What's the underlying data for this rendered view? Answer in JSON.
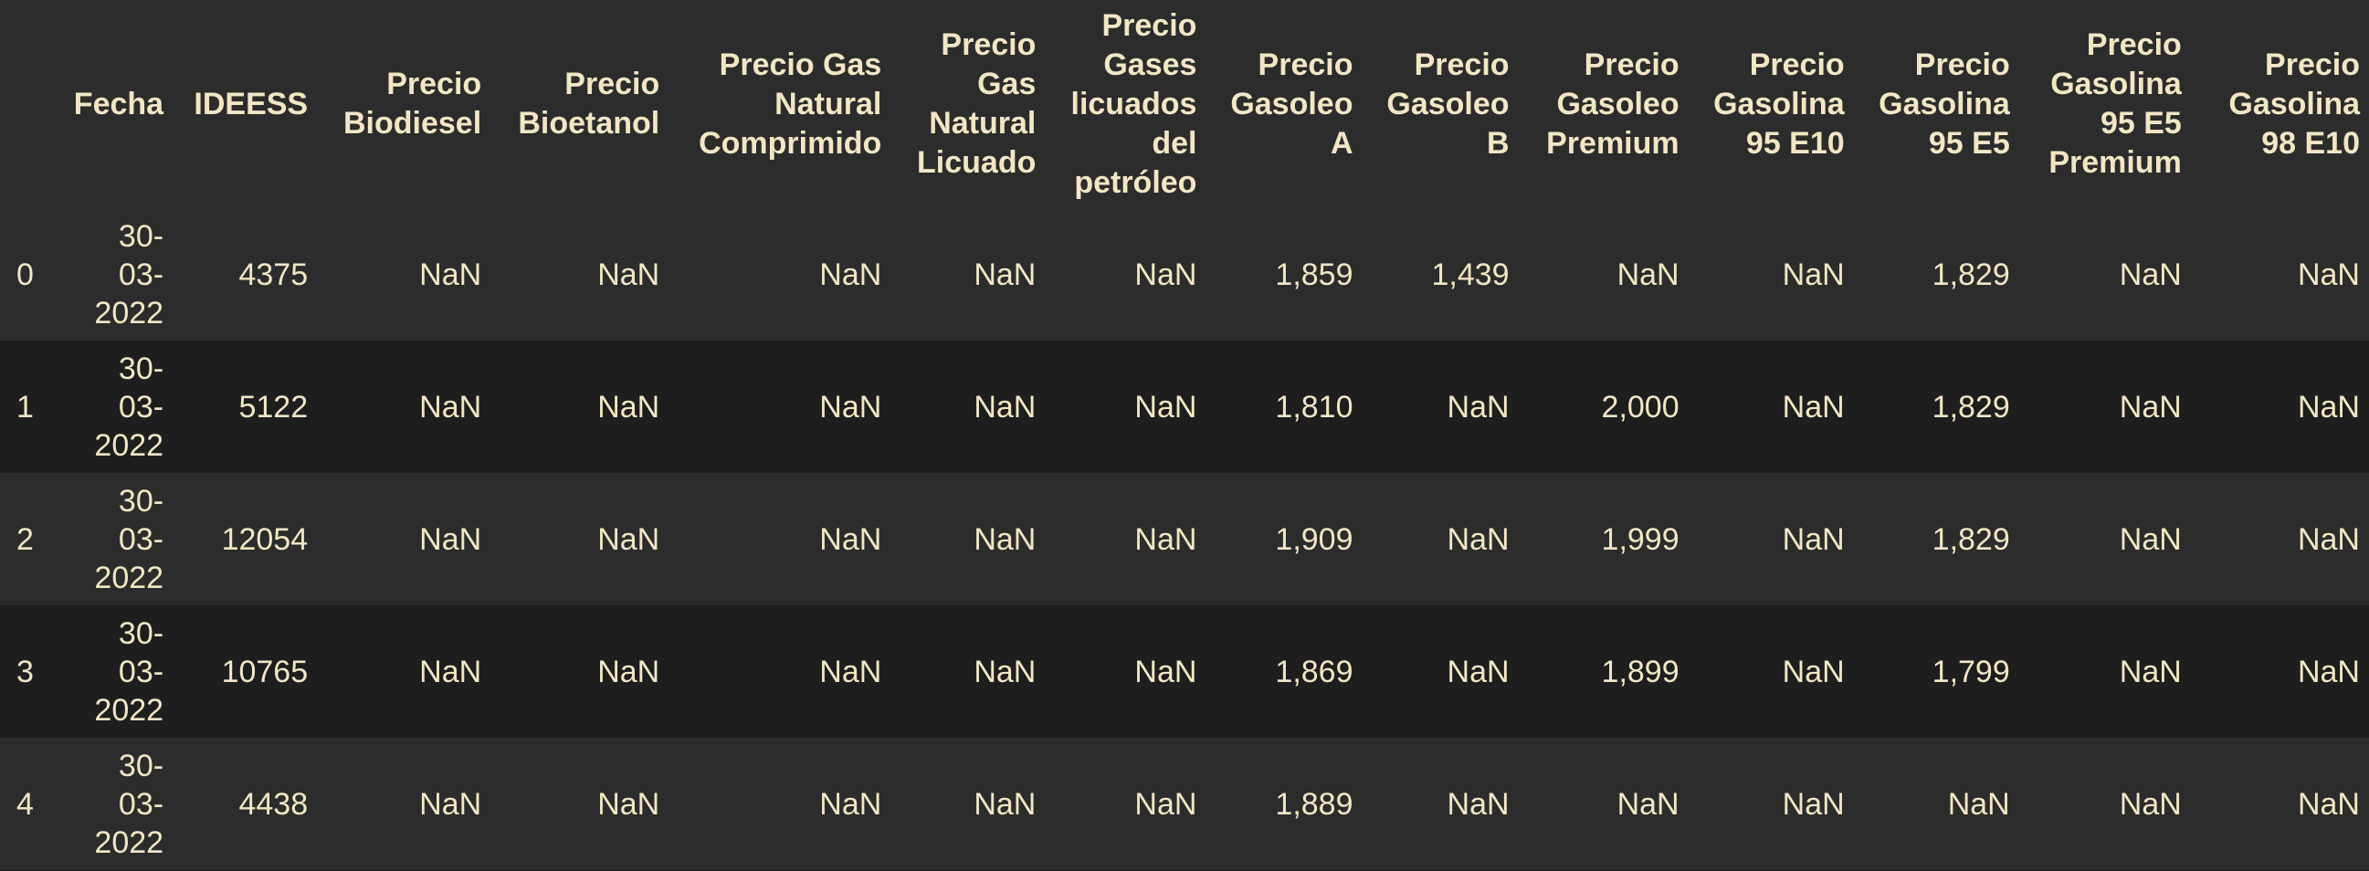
{
  "table": {
    "columns": [
      "",
      "Fecha",
      "IDEESS",
      "Precio Biodiesel",
      "Precio Bioetanol",
      "Precio Gas Natural Comprimido",
      "Precio Gas Natural Licuado",
      "Precio Gases licuados del petróleo",
      "Precio Gasoleo A",
      "Precio Gasoleo B",
      "Precio Gasoleo Premium",
      "Precio Gasolina 95 E10",
      "Precio Gasolina 95 E5",
      "Precio Gasolina 95 E5 Premium",
      "Precio Gasolina 98 E10"
    ],
    "column_header_lines": [
      [
        ""
      ],
      [
        "Fecha"
      ],
      [
        "IDEESS"
      ],
      [
        "Precio",
        "Biodiesel"
      ],
      [
        "Precio",
        "Bioetanol"
      ],
      [
        "Precio Gas",
        "Natural",
        "Comprimido"
      ],
      [
        "Precio",
        "Gas",
        "Natural",
        "Licuado"
      ],
      [
        "Precio",
        "Gases",
        "licuados",
        "del",
        "petróleo"
      ],
      [
        "Precio",
        "Gasoleo",
        "A"
      ],
      [
        "Precio",
        "Gasoleo",
        "B"
      ],
      [
        "Precio",
        "Gasoleo",
        "Premium"
      ],
      [
        "Precio",
        "Gasolina",
        "95 E10"
      ],
      [
        "Precio",
        "Gasolina",
        "95 E5"
      ],
      [
        "Precio",
        "Gasolina",
        "95 E5",
        "Premium"
      ],
      [
        "Precio",
        "Gasolina",
        "98 E10"
      ]
    ],
    "rows": [
      {
        "index": "0",
        "fecha_lines": [
          "30-",
          "03-",
          "2022"
        ],
        "cells": [
          "4375",
          "NaN",
          "NaN",
          "NaN",
          "NaN",
          "NaN",
          "1,859",
          "1,439",
          "NaN",
          "NaN",
          "1,829",
          "NaN",
          "NaN"
        ]
      },
      {
        "index": "1",
        "fecha_lines": [
          "30-",
          "03-",
          "2022"
        ],
        "cells": [
          "5122",
          "NaN",
          "NaN",
          "NaN",
          "NaN",
          "NaN",
          "1,810",
          "NaN",
          "2,000",
          "NaN",
          "1,829",
          "NaN",
          "NaN"
        ]
      },
      {
        "index": "2",
        "fecha_lines": [
          "30-",
          "03-",
          "2022"
        ],
        "cells": [
          "12054",
          "NaN",
          "NaN",
          "NaN",
          "NaN",
          "NaN",
          "1,909",
          "NaN",
          "1,999",
          "NaN",
          "1,829",
          "NaN",
          "NaN"
        ]
      },
      {
        "index": "3",
        "fecha_lines": [
          "30-",
          "03-",
          "2022"
        ],
        "cells": [
          "10765",
          "NaN",
          "NaN",
          "NaN",
          "NaN",
          "NaN",
          "1,869",
          "NaN",
          "1,899",
          "NaN",
          "1,799",
          "NaN",
          "NaN"
        ]
      },
      {
        "index": "4",
        "fecha_lines": [
          "30-",
          "03-",
          "2022"
        ],
        "cells": [
          "4438",
          "NaN",
          "NaN",
          "NaN",
          "NaN",
          "NaN",
          "1,889",
          "NaN",
          "NaN",
          "NaN",
          "NaN",
          "NaN",
          "NaN"
        ]
      }
    ]
  },
  "colors": {
    "text": "#f2e6c4",
    "header_bg": "#2c2c2c",
    "row_alt_bg": "#2c2c2c",
    "row_bg": "#1e1e1e"
  }
}
